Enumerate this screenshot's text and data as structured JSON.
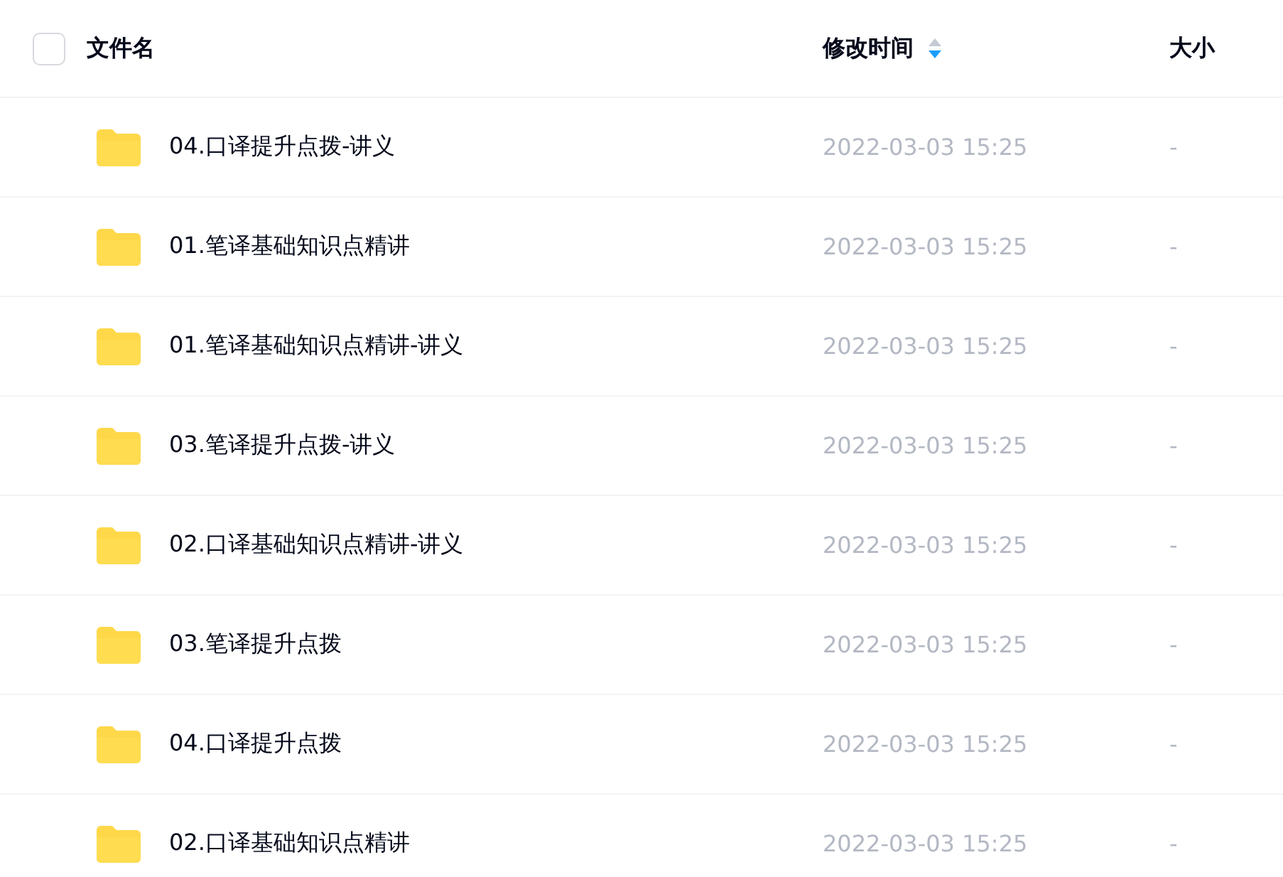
{
  "header": {
    "select_all": {
      "checked": false
    },
    "columns": [
      {
        "label": "文件名"
      },
      {
        "label": "修改时间",
        "sort_descending": true
      },
      {
        "label": "大小"
      }
    ]
  },
  "rows": [
    {
      "name": "04.口译提升点拨-讲义",
      "modified": "2022-03-03 15:25",
      "size": "-"
    },
    {
      "name": "01.笔译基础知识点精讲",
      "modified": "2022-03-03 15:25",
      "size": "-"
    },
    {
      "name": "01.笔译基础知识点精讲-讲义",
      "modified": "2022-03-03 15:25",
      "size": "-"
    },
    {
      "name": "03.笔译提升点拨-讲义",
      "modified": "2022-03-03 15:25",
      "size": "-"
    },
    {
      "name": "02.口译基础知识点精讲-讲义",
      "modified": "2022-03-03 15:25",
      "size": "-"
    },
    {
      "name": "03.笔译提升点拨",
      "modified": "2022-03-03 15:25",
      "size": "-"
    },
    {
      "name": "04.口译提升点拨",
      "modified": "2022-03-03 15:25",
      "size": "-"
    },
    {
      "name": "02.口译基础知识点精讲",
      "modified": "2022-03-03 15:25",
      "size": "-"
    }
  ]
}
